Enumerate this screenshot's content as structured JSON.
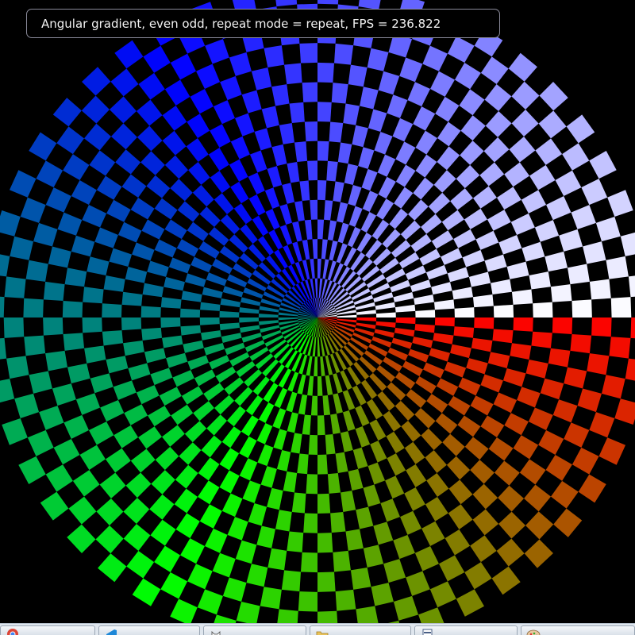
{
  "overlay": {
    "text": "Angular gradient, even odd, repeat mode = repeat, FPS = 236.822"
  },
  "render": {
    "background": "#000000",
    "rings": 17,
    "sectors": 96,
    "gradient_stops": [
      "#ff0000",
      "#00ff00",
      "#0000ff",
      "#ffffff"
    ],
    "fill_rule": "even-odd",
    "repeat_mode": "repeat"
  },
  "taskbar": {
    "items": [
      {
        "icon": "chrome-icon",
        "label": ""
      },
      {
        "icon": "vscode-icon",
        "label": ""
      },
      {
        "icon": "github-icon",
        "label": ""
      },
      {
        "icon": "folder-icon",
        "label": ""
      },
      {
        "icon": "document-icon",
        "label": ""
      },
      {
        "icon": "paint-icon",
        "label": ""
      }
    ]
  }
}
